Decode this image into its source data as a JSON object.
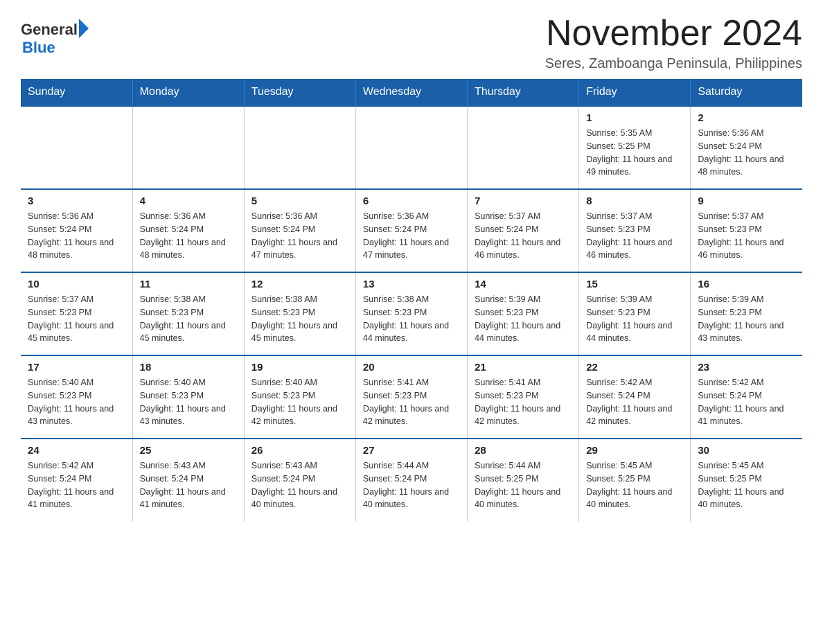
{
  "header": {
    "logo_general": "General",
    "logo_blue": "Blue",
    "month_title": "November 2024",
    "location": "Seres, Zamboanga Peninsula, Philippines"
  },
  "weekdays": [
    "Sunday",
    "Monday",
    "Tuesday",
    "Wednesday",
    "Thursday",
    "Friday",
    "Saturday"
  ],
  "weeks": [
    [
      {
        "day": "",
        "sunrise": "",
        "sunset": "",
        "daylight": ""
      },
      {
        "day": "",
        "sunrise": "",
        "sunset": "",
        "daylight": ""
      },
      {
        "day": "",
        "sunrise": "",
        "sunset": "",
        "daylight": ""
      },
      {
        "day": "",
        "sunrise": "",
        "sunset": "",
        "daylight": ""
      },
      {
        "day": "",
        "sunrise": "",
        "sunset": "",
        "daylight": ""
      },
      {
        "day": "1",
        "sunrise": "Sunrise: 5:35 AM",
        "sunset": "Sunset: 5:25 PM",
        "daylight": "Daylight: 11 hours and 49 minutes."
      },
      {
        "day": "2",
        "sunrise": "Sunrise: 5:36 AM",
        "sunset": "Sunset: 5:24 PM",
        "daylight": "Daylight: 11 hours and 48 minutes."
      }
    ],
    [
      {
        "day": "3",
        "sunrise": "Sunrise: 5:36 AM",
        "sunset": "Sunset: 5:24 PM",
        "daylight": "Daylight: 11 hours and 48 minutes."
      },
      {
        "day": "4",
        "sunrise": "Sunrise: 5:36 AM",
        "sunset": "Sunset: 5:24 PM",
        "daylight": "Daylight: 11 hours and 48 minutes."
      },
      {
        "day": "5",
        "sunrise": "Sunrise: 5:36 AM",
        "sunset": "Sunset: 5:24 PM",
        "daylight": "Daylight: 11 hours and 47 minutes."
      },
      {
        "day": "6",
        "sunrise": "Sunrise: 5:36 AM",
        "sunset": "Sunset: 5:24 PM",
        "daylight": "Daylight: 11 hours and 47 minutes."
      },
      {
        "day": "7",
        "sunrise": "Sunrise: 5:37 AM",
        "sunset": "Sunset: 5:24 PM",
        "daylight": "Daylight: 11 hours and 46 minutes."
      },
      {
        "day": "8",
        "sunrise": "Sunrise: 5:37 AM",
        "sunset": "Sunset: 5:23 PM",
        "daylight": "Daylight: 11 hours and 46 minutes."
      },
      {
        "day": "9",
        "sunrise": "Sunrise: 5:37 AM",
        "sunset": "Sunset: 5:23 PM",
        "daylight": "Daylight: 11 hours and 46 minutes."
      }
    ],
    [
      {
        "day": "10",
        "sunrise": "Sunrise: 5:37 AM",
        "sunset": "Sunset: 5:23 PM",
        "daylight": "Daylight: 11 hours and 45 minutes."
      },
      {
        "day": "11",
        "sunrise": "Sunrise: 5:38 AM",
        "sunset": "Sunset: 5:23 PM",
        "daylight": "Daylight: 11 hours and 45 minutes."
      },
      {
        "day": "12",
        "sunrise": "Sunrise: 5:38 AM",
        "sunset": "Sunset: 5:23 PM",
        "daylight": "Daylight: 11 hours and 45 minutes."
      },
      {
        "day": "13",
        "sunrise": "Sunrise: 5:38 AM",
        "sunset": "Sunset: 5:23 PM",
        "daylight": "Daylight: 11 hours and 44 minutes."
      },
      {
        "day": "14",
        "sunrise": "Sunrise: 5:39 AM",
        "sunset": "Sunset: 5:23 PM",
        "daylight": "Daylight: 11 hours and 44 minutes."
      },
      {
        "day": "15",
        "sunrise": "Sunrise: 5:39 AM",
        "sunset": "Sunset: 5:23 PM",
        "daylight": "Daylight: 11 hours and 44 minutes."
      },
      {
        "day": "16",
        "sunrise": "Sunrise: 5:39 AM",
        "sunset": "Sunset: 5:23 PM",
        "daylight": "Daylight: 11 hours and 43 minutes."
      }
    ],
    [
      {
        "day": "17",
        "sunrise": "Sunrise: 5:40 AM",
        "sunset": "Sunset: 5:23 PM",
        "daylight": "Daylight: 11 hours and 43 minutes."
      },
      {
        "day": "18",
        "sunrise": "Sunrise: 5:40 AM",
        "sunset": "Sunset: 5:23 PM",
        "daylight": "Daylight: 11 hours and 43 minutes."
      },
      {
        "day": "19",
        "sunrise": "Sunrise: 5:40 AM",
        "sunset": "Sunset: 5:23 PM",
        "daylight": "Daylight: 11 hours and 42 minutes."
      },
      {
        "day": "20",
        "sunrise": "Sunrise: 5:41 AM",
        "sunset": "Sunset: 5:23 PM",
        "daylight": "Daylight: 11 hours and 42 minutes."
      },
      {
        "day": "21",
        "sunrise": "Sunrise: 5:41 AM",
        "sunset": "Sunset: 5:23 PM",
        "daylight": "Daylight: 11 hours and 42 minutes."
      },
      {
        "day": "22",
        "sunrise": "Sunrise: 5:42 AM",
        "sunset": "Sunset: 5:24 PM",
        "daylight": "Daylight: 11 hours and 42 minutes."
      },
      {
        "day": "23",
        "sunrise": "Sunrise: 5:42 AM",
        "sunset": "Sunset: 5:24 PM",
        "daylight": "Daylight: 11 hours and 41 minutes."
      }
    ],
    [
      {
        "day": "24",
        "sunrise": "Sunrise: 5:42 AM",
        "sunset": "Sunset: 5:24 PM",
        "daylight": "Daylight: 11 hours and 41 minutes."
      },
      {
        "day": "25",
        "sunrise": "Sunrise: 5:43 AM",
        "sunset": "Sunset: 5:24 PM",
        "daylight": "Daylight: 11 hours and 41 minutes."
      },
      {
        "day": "26",
        "sunrise": "Sunrise: 5:43 AM",
        "sunset": "Sunset: 5:24 PM",
        "daylight": "Daylight: 11 hours and 40 minutes."
      },
      {
        "day": "27",
        "sunrise": "Sunrise: 5:44 AM",
        "sunset": "Sunset: 5:24 PM",
        "daylight": "Daylight: 11 hours and 40 minutes."
      },
      {
        "day": "28",
        "sunrise": "Sunrise: 5:44 AM",
        "sunset": "Sunset: 5:25 PM",
        "daylight": "Daylight: 11 hours and 40 minutes."
      },
      {
        "day": "29",
        "sunrise": "Sunrise: 5:45 AM",
        "sunset": "Sunset: 5:25 PM",
        "daylight": "Daylight: 11 hours and 40 minutes."
      },
      {
        "day": "30",
        "sunrise": "Sunrise: 5:45 AM",
        "sunset": "Sunset: 5:25 PM",
        "daylight": "Daylight: 11 hours and 40 minutes."
      }
    ]
  ]
}
